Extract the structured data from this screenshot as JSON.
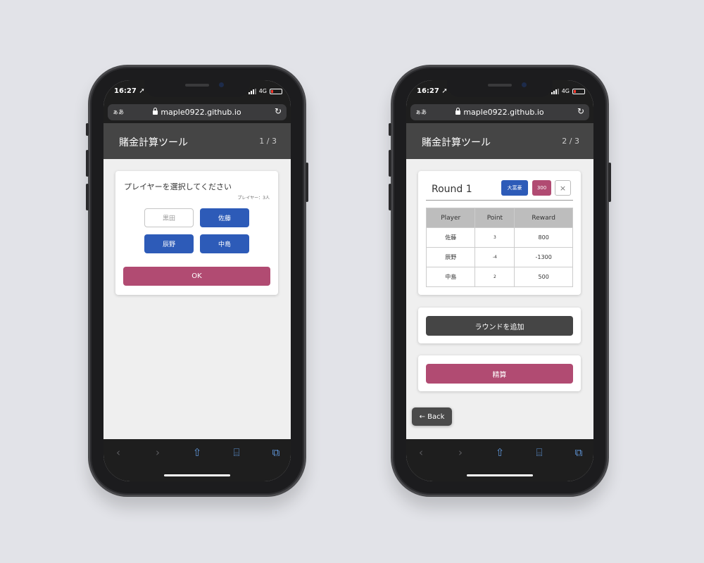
{
  "colors": {
    "accent_blue": "#2d5bb8",
    "accent_pink": "#b14b72",
    "header": "#454545",
    "ios_blue": "#5f95d8"
  },
  "left": {
    "status": {
      "time": "16:27 ➚",
      "network": "4G"
    },
    "browser": {
      "reader": "ぁあ",
      "url": "maple0922.github.io"
    },
    "header": {
      "title": "賭金計算ツール",
      "page": "1 / 3"
    },
    "select": {
      "title": "プレイヤーを選択してください",
      "count": "プレイヤー：3人",
      "players": [
        {
          "name": "黒田",
          "selected": false
        },
        {
          "name": "佐藤",
          "selected": true
        },
        {
          "name": "辰野",
          "selected": true
        },
        {
          "name": "中島",
          "selected": true
        }
      ],
      "ok_label": "OK"
    }
  },
  "right": {
    "status": {
      "time": "16:27 ➚",
      "network": "4G"
    },
    "browser": {
      "reader": "ぁあ",
      "url": "maple0922.github.io"
    },
    "header": {
      "title": "賭金計算ツール",
      "page": "2 / 3"
    },
    "round": {
      "title": "Round 1",
      "rich_label": "大富豪",
      "points_label": "300",
      "close_label": "×",
      "columns": [
        "Player",
        "Point",
        "Reward"
      ],
      "rows": [
        {
          "player": "佐藤",
          "point": "3",
          "reward": "800"
        },
        {
          "player": "辰野",
          "point": "-4",
          "reward": "-1300"
        },
        {
          "player": "中島",
          "point": "2",
          "reward": "500"
        }
      ]
    },
    "add_round_label": "ラウンドを追加",
    "settle_label": "精算",
    "back_label": "← Back"
  },
  "toolbar_icons": [
    "back-icon",
    "forward-icon",
    "share-icon",
    "bookmarks-icon",
    "tabs-icon"
  ]
}
